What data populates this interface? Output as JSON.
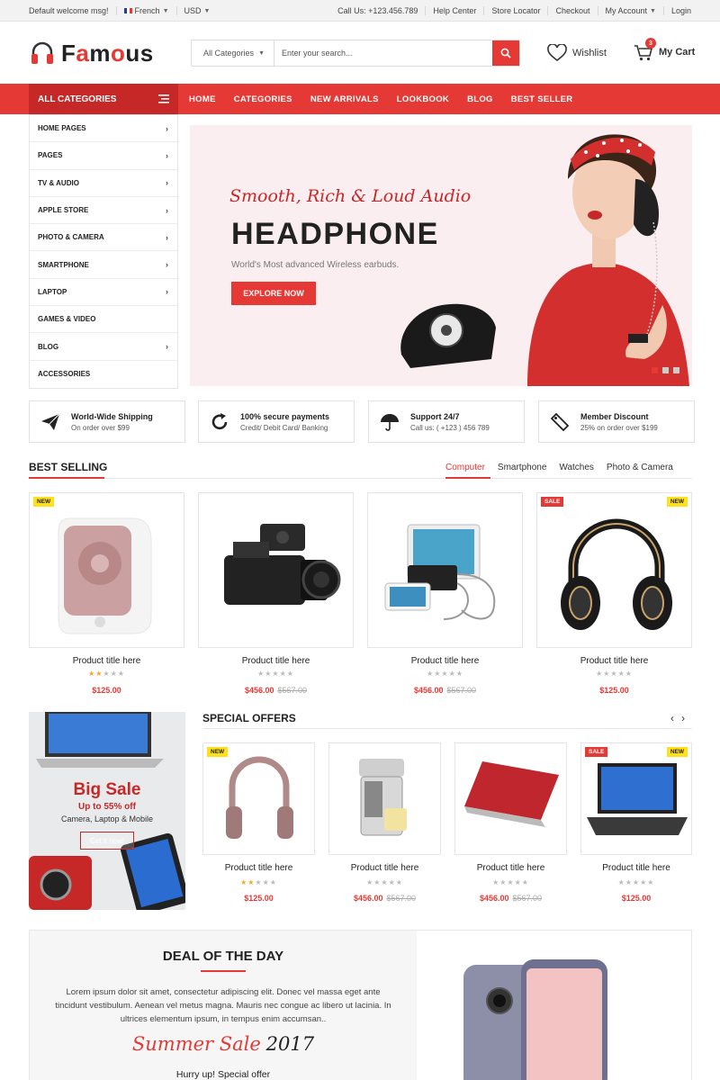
{
  "topbar": {
    "welcome": "Default welcome msg!",
    "language": "French",
    "currency": "USD",
    "call": "Call Us: +123.456.789",
    "links": [
      "Help Center",
      "Store Locator",
      "Checkout",
      "My Account",
      "Login"
    ]
  },
  "header": {
    "logo": "Famous",
    "search_category": "All Categories",
    "search_placeholder": "Enter your search...",
    "wishlist": "Wishlist",
    "cart": "My Cart",
    "cart_count": "3"
  },
  "nav": {
    "all_categories": "ALL CATEGORIES",
    "links": [
      "HOME",
      "CATEGORIES",
      "NEW ARRIVALS",
      "LOOKBOOK",
      "BLOG",
      "BEST SELLER"
    ]
  },
  "sidemenu": [
    {
      "label": "HOME PAGES",
      "arrow": true
    },
    {
      "label": "PAGES",
      "arrow": true
    },
    {
      "label": "TV & AUDIO",
      "arrow": true
    },
    {
      "label": "APPLE STORE",
      "arrow": true
    },
    {
      "label": "PHOTO & CAMERA",
      "arrow": true
    },
    {
      "label": "SMARTPHONE",
      "arrow": true
    },
    {
      "label": "LAPTOP",
      "arrow": true
    },
    {
      "label": "GAMES & VIDEO",
      "arrow": false
    },
    {
      "label": "BLOG",
      "arrow": true
    },
    {
      "label": "ACCESSORIES",
      "arrow": false
    }
  ],
  "hero": {
    "tagline": "Smooth, Rich & Loud Audio",
    "title": "HEADPHONE",
    "subtitle": "World's Most advanced Wireless earbuds.",
    "cta": "EXPLORE NOW"
  },
  "features": [
    {
      "icon": "paper-plane-icon",
      "title": "World-Wide Shipping",
      "sub": "On order over $99"
    },
    {
      "icon": "refresh-icon",
      "title": "100% secure payments",
      "sub": "Credit/ Debit Card/ Banking"
    },
    {
      "icon": "umbrella-icon",
      "title": "Support 24/7",
      "sub": "Call us: ( +123 ) 456 789"
    },
    {
      "icon": "tag-icon",
      "title": "Member Discount",
      "sub": "25% on order over $199"
    }
  ],
  "best_selling": {
    "title": "BEST SELLING",
    "tabs": [
      "Computer",
      "Smartphone",
      "Watches",
      "Photo & Camera"
    ],
    "active_tab": "Computer",
    "products": [
      {
        "title": "Product title here",
        "rating": 2,
        "price": "$125.00",
        "old_price": "",
        "label": "NEW",
        "image": "speaker"
      },
      {
        "title": "Product title here",
        "rating": 0,
        "price": "$456.00",
        "old_price": "$567.00",
        "label": "",
        "image": "camcorder"
      },
      {
        "title": "Product title here",
        "rating": 0,
        "price": "$456.00",
        "old_price": "$567.00",
        "label": "",
        "image": "powerbank"
      },
      {
        "title": "Product title here",
        "rating": 0,
        "price": "$125.00",
        "old_price": "",
        "label": "SALE NEW",
        "image": "headphones"
      }
    ]
  },
  "big_sale": {
    "title": "Big Sale",
    "offer": "Up to 55% off",
    "categories": "Camera, Laptop & Mobile",
    "button": "Get it now!"
  },
  "special_offers": {
    "title": "SPECIAL OFFERS",
    "products": [
      {
        "title": "Product title here",
        "rating": 2,
        "price": "$125.00",
        "old_price": "",
        "label": "NEW",
        "image": "pink-headphones"
      },
      {
        "title": "Product title here",
        "rating": 0,
        "price": "$456.00",
        "old_price": "$567.00",
        "label": "",
        "image": "juicer"
      },
      {
        "title": "Product title here",
        "rating": 0,
        "price": "$456.00",
        "old_price": "$567.00",
        "label": "",
        "image": "red-laptop"
      },
      {
        "title": "Product title here",
        "rating": 0,
        "price": "$125.00",
        "old_price": "",
        "label": "SALE NEW",
        "image": "laptop"
      }
    ]
  },
  "deal": {
    "title": "DEAL OF THE DAY",
    "text": "Lorem ipsum dolor sit amet, consectetur adipiscing elit. Donec vel massa eget ante tincidunt vestibulum. Aenean vel metus magna. Mauris nec congue ac libero ut lacinia. In ultrices elementum ipsum, in tempus enim accumsan..",
    "summer": "Summer Sale",
    "year": "2017",
    "hurry": "Hurry up! Special offer"
  },
  "colors": {
    "accent": "#e53935",
    "accent_dark": "#c62828",
    "new_label": "#ffe01b",
    "star": "#f5a623"
  }
}
